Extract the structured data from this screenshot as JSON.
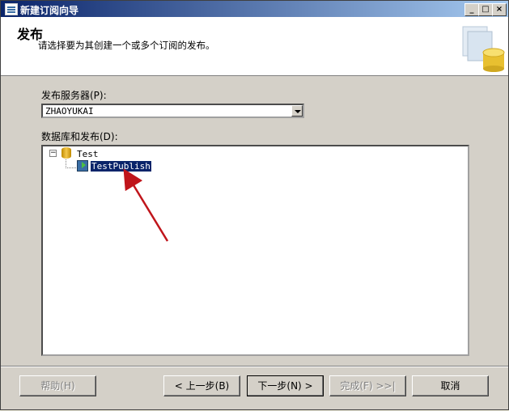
{
  "window": {
    "title": "新建订阅向导"
  },
  "header": {
    "title": "发布",
    "subtitle": "请选择要为其创建一个或多个订阅的发布。"
  },
  "publisher": {
    "label": "发布服务器(P):",
    "value": "ZHAOYUKAI"
  },
  "databases": {
    "label": "数据库和发布(D):",
    "tree": [
      {
        "name": "Test",
        "expanded": true,
        "children": [
          {
            "name": "TestPublish",
            "selected": true
          }
        ]
      }
    ]
  },
  "buttons": {
    "help": "帮助(H)",
    "back": "< 上一步(B)",
    "next": "下一步(N) >",
    "finish": "完成(F) >>|",
    "cancel": "取消"
  },
  "colors": {
    "selection": "#0a246a",
    "annotation_arrow": "#c0151b"
  }
}
